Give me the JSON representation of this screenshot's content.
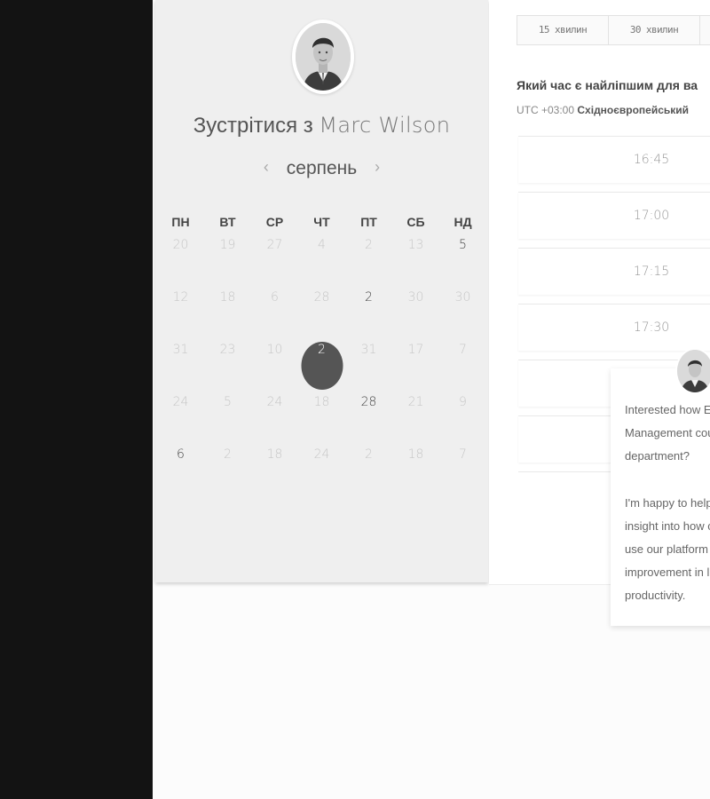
{
  "colors": {
    "left_strip": "#131313",
    "calendar_bg": "#efefef",
    "selected_day": "#555555",
    "panel_bg": "#ffffff"
  },
  "header": {
    "title_prefix": "Зустрітися з",
    "title_name": "Marc Wilson"
  },
  "calendar": {
    "month": "серпень",
    "prev_icon": "‹",
    "next_icon": "›",
    "weekdays": [
      "ПН",
      "ВТ",
      "СР",
      "ЧТ",
      "ПТ",
      "СБ",
      "НД"
    ],
    "weeks": [
      [
        "20",
        "19",
        "27",
        "4",
        "2",
        "13",
        "5"
      ],
      [
        "12",
        "18",
        "6",
        "28",
        "2",
        "30",
        "30"
      ],
      [
        "31",
        "23",
        "10",
        "2",
        "31",
        "17",
        "7"
      ],
      [
        "24",
        "5",
        "24",
        "18",
        "28",
        "21",
        "9"
      ],
      [
        "6",
        "2",
        "18",
        "24",
        "2",
        "18",
        "7"
      ]
    ],
    "active_days": [
      [
        0,
        6
      ],
      [
        1,
        4
      ],
      [
        3,
        4
      ],
      [
        4,
        0
      ]
    ],
    "selected_day": [
      2,
      3
    ]
  },
  "durations": {
    "tabs": [
      "15 хвилин",
      "30 хвилин",
      ""
    ]
  },
  "booking": {
    "question": "Який час є найліпшим для ва",
    "timezone_offset": "UTC +03:00",
    "timezone_name": "Східноєвропейський"
  },
  "slots": [
    "16:45",
    "17:00",
    "17:15",
    "17:30",
    "",
    "",
    ""
  ],
  "chat": {
    "lines": [
      "Interested how E",
      "Management cou",
      "department?",
      "",
      "I'm happy to help",
      "insight into how c",
      "use our platform",
      "improvement in l",
      "productivity."
    ]
  }
}
